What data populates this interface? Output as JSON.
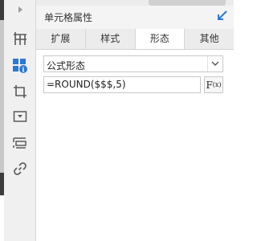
{
  "panel": {
    "title": "单元格属性"
  },
  "tabs": [
    {
      "label": "扩展",
      "active": false
    },
    {
      "label": "样式",
      "active": false
    },
    {
      "label": "形态",
      "active": true
    },
    {
      "label": "其他",
      "active": false
    }
  ],
  "form": {
    "format_select_value": "公式形态",
    "formula_value": "=ROUND($$$,5)",
    "fx_label": "F",
    "fx_sub": "(x)"
  },
  "colors": {
    "accent": "#2b78d4",
    "icon": "#5a5a5a"
  },
  "sidebar_icons": [
    "grid-icon",
    "widgets-icon",
    "crop-icon",
    "dropdown-icon",
    "layout-icon",
    "link-icon"
  ]
}
